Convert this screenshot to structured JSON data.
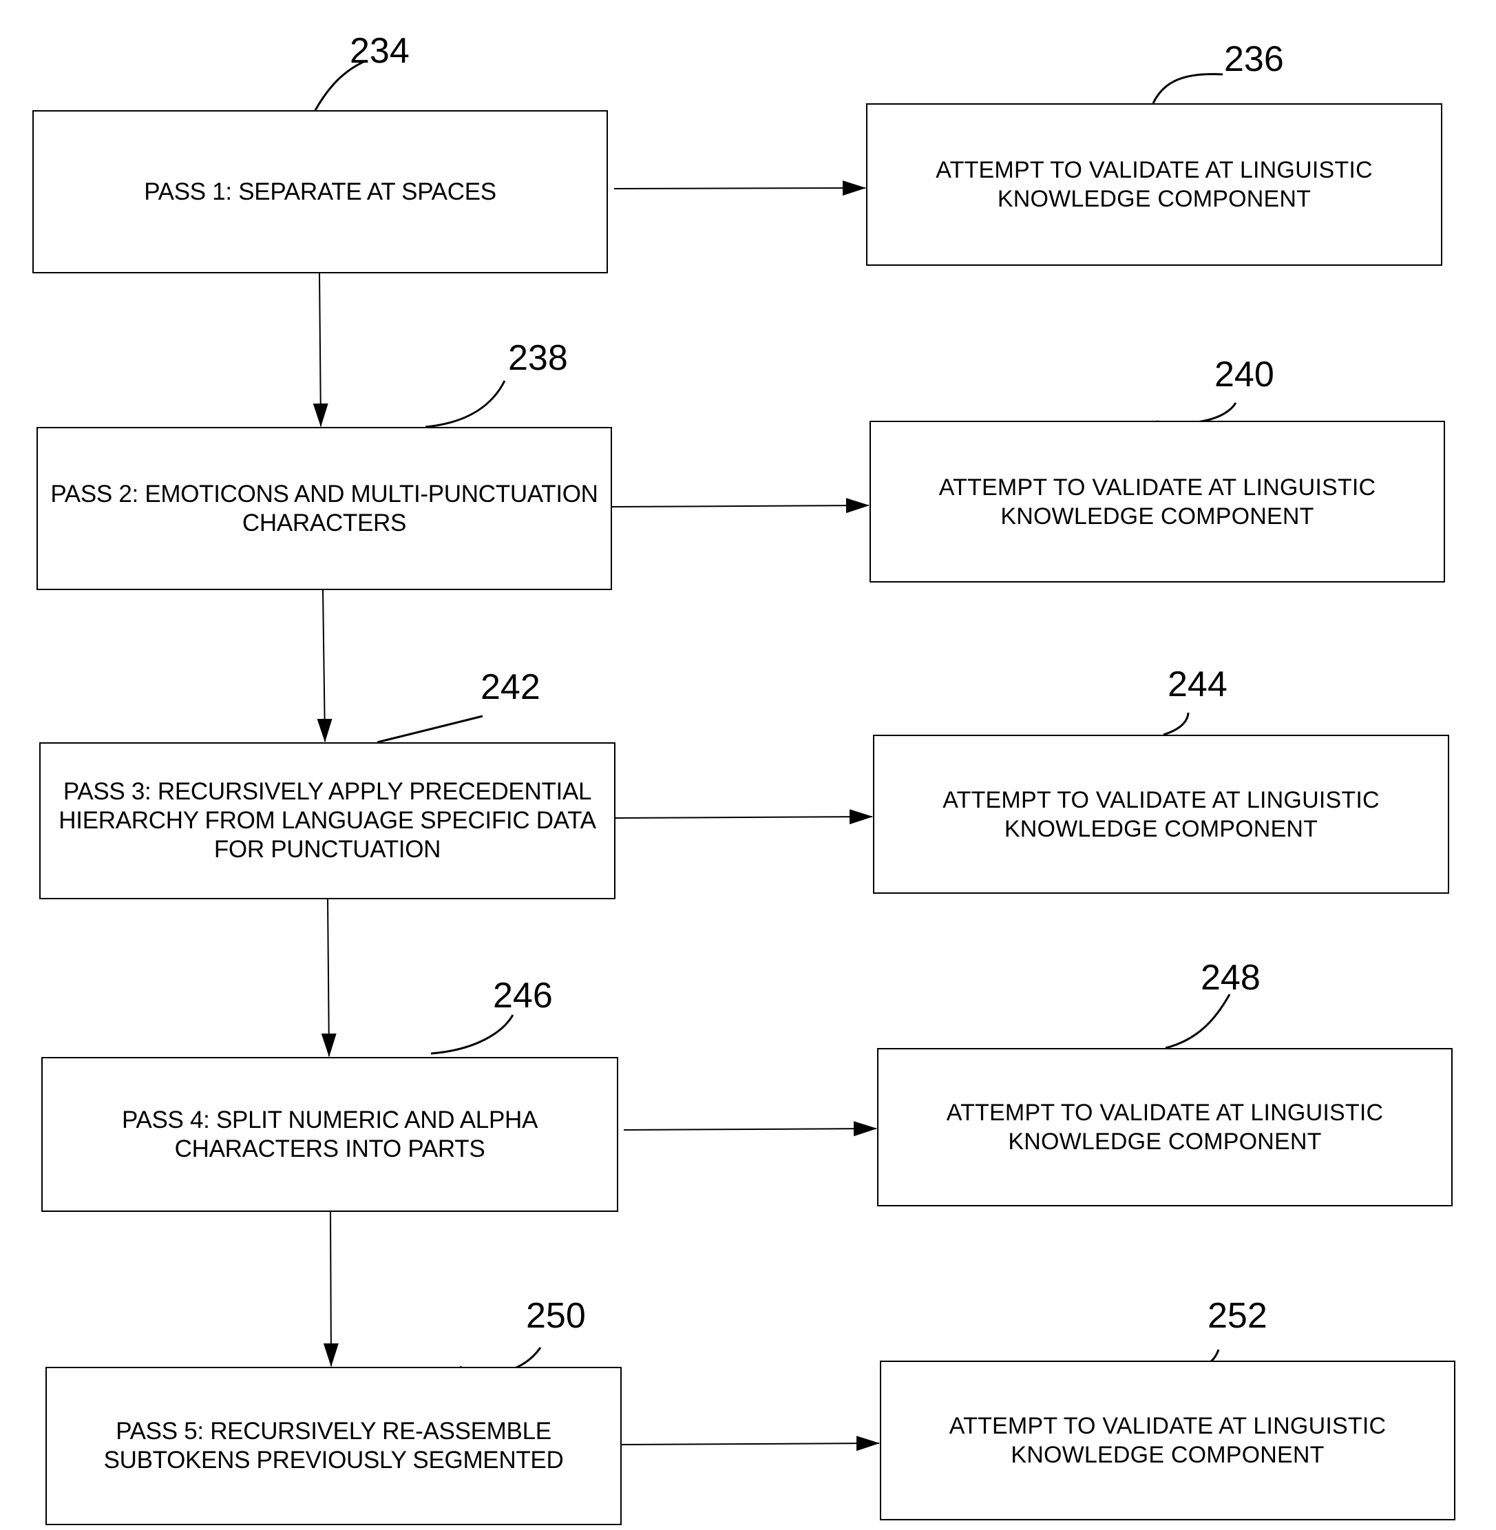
{
  "diagram": {
    "type": "flowchart",
    "steps": [
      {
        "ref": "234",
        "text": "PASS 1: SEPARATE AT SPACES",
        "validate": {
          "ref": "236",
          "text": "ATTEMPT TO VALIDATE AT LINGUISTIC KNOWLEDGE COMPONENT"
        }
      },
      {
        "ref": "238",
        "text": "PASS 2: EMOTICONS AND MULTI-PUNCTUATION CHARACTERS",
        "validate": {
          "ref": "240",
          "text": "ATTEMPT TO VALIDATE AT LINGUISTIC KNOWLEDGE COMPONENT"
        }
      },
      {
        "ref": "242",
        "text": "PASS 3: RECURSIVELY APPLY PRECEDENTIAL HIERARCHY FROM LANGUAGE SPECIFIC DATA FOR PUNCTUATION",
        "validate": {
          "ref": "244",
          "text": "ATTEMPT TO VALIDATE AT LINGUISTIC KNOWLEDGE COMPONENT"
        }
      },
      {
        "ref": "246",
        "text": "PASS 4: SPLIT NUMERIC AND ALPHA CHARACTERS INTO PARTS",
        "validate": {
          "ref": "248",
          "text": "ATTEMPT TO VALIDATE AT LINGUISTIC KNOWLEDGE COMPONENT"
        }
      },
      {
        "ref": "250",
        "text": "PASS 5: RECURSIVELY RE-ASSEMBLE SUBTOKENS PREVIOUSLY SEGMENTED",
        "validate": {
          "ref": "252",
          "text": "ATTEMPT TO VALIDATE AT LINGUISTIC KNOWLEDGE COMPONENT"
        }
      }
    ],
    "edges": [
      {
        "from": "234",
        "to": "236"
      },
      {
        "from": "234",
        "to": "238"
      },
      {
        "from": "238",
        "to": "240"
      },
      {
        "from": "238",
        "to": "242"
      },
      {
        "from": "242",
        "to": "244"
      },
      {
        "from": "242",
        "to": "246"
      },
      {
        "from": "246",
        "to": "248"
      },
      {
        "from": "246",
        "to": "250"
      },
      {
        "from": "250",
        "to": "252"
      }
    ]
  }
}
